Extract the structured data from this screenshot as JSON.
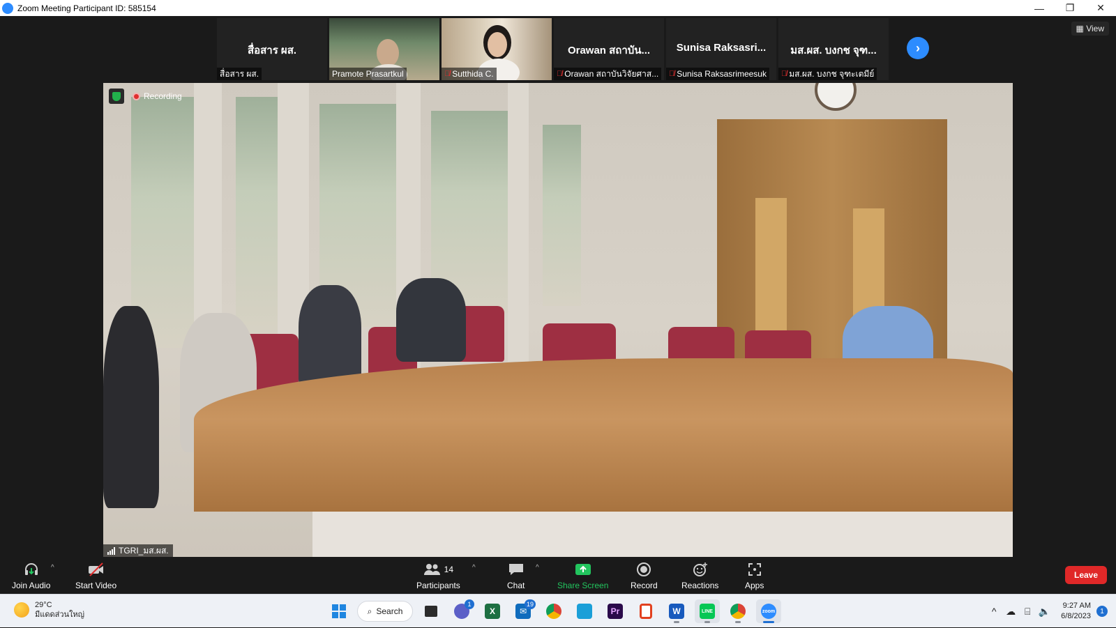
{
  "window": {
    "title": "Zoom Meeting Participant ID: 585154",
    "minimize": "—",
    "restore": "❐",
    "close": "✕"
  },
  "thumbnails": [
    {
      "display_name": "สื่อสาร ผส.",
      "label": "สื่อสาร ผส.",
      "muted": false,
      "video": false
    },
    {
      "display_name": "",
      "label": "Pramote Prasartkul",
      "muted": false,
      "video": true
    },
    {
      "display_name": "",
      "label": "Sutthida C.",
      "muted": true,
      "video": true
    },
    {
      "display_name": "Orawan สถาบัน...",
      "label": "Orawan สถาบันวิจัยศาส...",
      "muted": true,
      "video": false
    },
    {
      "display_name": "Sunisa  Raksasri...",
      "label": "Sunisa Raksasrimeesuk",
      "muted": true,
      "video": false
    },
    {
      "display_name": "มส.ผส.  บงกช จุฑ...",
      "label": "มส.ผส. บงกช จุฑะเตมีย์",
      "muted": true,
      "video": false
    }
  ],
  "view_button": "View",
  "main_video": {
    "recording_label": "Recording",
    "speaker_label": "TGRI_มส.ผส."
  },
  "toolbar": {
    "join_audio": "Join Audio",
    "start_video": "Start Video",
    "participants": "Participants",
    "participants_count": "14",
    "chat": "Chat",
    "share_screen": "Share Screen",
    "record": "Record",
    "reactions": "Reactions",
    "apps": "Apps",
    "leave": "Leave"
  },
  "taskbar": {
    "weather_temp": "29°C",
    "weather_desc": "มีแดดส่วนใหญ่",
    "search_label": "Search",
    "teams_badge": "1",
    "mail_badge": "19",
    "time": "9:27 AM",
    "date": "6/8/2023",
    "notification_count": "1"
  },
  "colors": {
    "zoom_blue": "#2d8cff",
    "leave_red": "#e02828",
    "share_green": "#22c55e",
    "muted_red": "#e02f2f"
  }
}
